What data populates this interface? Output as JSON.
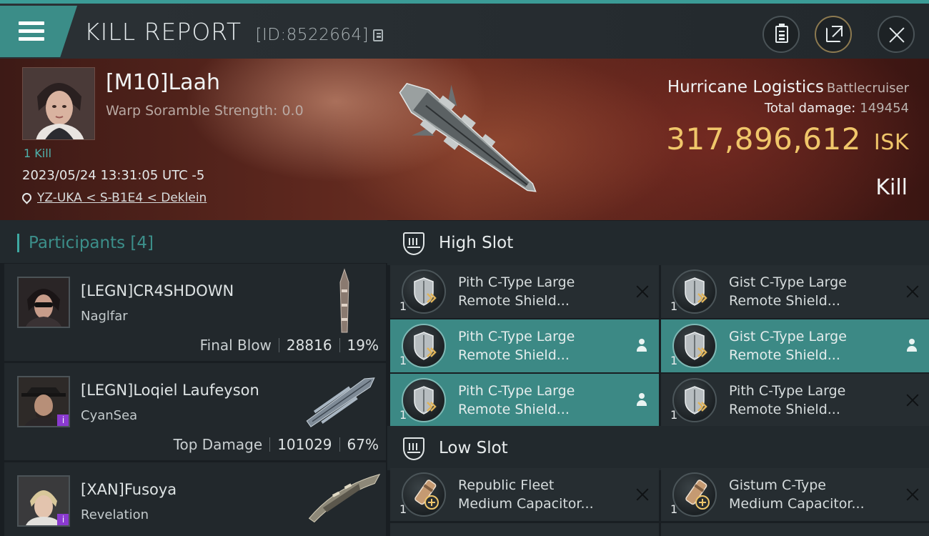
{
  "header": {
    "title": "KILL REPORT",
    "report_id": "[ID:8522664]"
  },
  "victim": {
    "name": "[M10]Laah",
    "warp_scramble": "Warp Soramble Strength: 0.0",
    "kill_count": "1 Kill",
    "datetime": "2023/05/24 13:31:05 UTC -5",
    "location": "YZ-UKA < S-B1E4 < Deklein",
    "ship_name": "Hurricane Logistics",
    "ship_class": "Battlecruiser",
    "total_damage_label": "Total damage:",
    "total_damage": "149454",
    "isk_value": "317,896,612",
    "isk_unit": "ISK",
    "result": "Kill"
  },
  "participants": {
    "label": "Participants",
    "count": "[4]",
    "items": [
      {
        "name": "[LEGN]CR4SHDOWN",
        "ship": "Naglfar",
        "tag": "Final Blow",
        "damage": "28816",
        "percent": "19%"
      },
      {
        "name": "[LEGN]Loqiel Laufeyson",
        "ship": "CyanSea",
        "tag": "Top Damage",
        "damage": "101029",
        "percent": "67%"
      },
      {
        "name": "[XAN]Fusoya",
        "ship": "Revelation"
      }
    ]
  },
  "fitting": {
    "high_slot": {
      "title": "High Slot",
      "modules": [
        {
          "qty": "1",
          "name_line1": "Pith C-Type Large",
          "name_line2": "Remote Shield...",
          "active": false
        },
        {
          "qty": "1",
          "name_line1": "Gist C-Type Large",
          "name_line2": "Remote Shield...",
          "active": false
        },
        {
          "qty": "1",
          "name_line1": "Pith C-Type Large",
          "name_line2": "Remote Shield...",
          "active": true
        },
        {
          "qty": "1",
          "name_line1": "Gist C-Type Large",
          "name_line2": "Remote Shield...",
          "active": true
        },
        {
          "qty": "1",
          "name_line1": "Pith C-Type Large",
          "name_line2": "Remote Shield...",
          "active": true
        },
        {
          "qty": "1",
          "name_line1": "Pith C-Type Large",
          "name_line2": "Remote Shield...",
          "active": false
        }
      ]
    },
    "low_slot": {
      "title": "Low Slot",
      "modules": [
        {
          "qty": "1",
          "name_line1": "Republic Fleet",
          "name_line2": "Medium Capacitor...",
          "active": false
        },
        {
          "qty": "1",
          "name_line1": "Gistum C-Type",
          "name_line2": "Medium Capacitor...",
          "active": false
        }
      ]
    }
  },
  "colors": {
    "accent_teal": "#3b8d88",
    "isk_gold": "#f0c66a",
    "banner_red": "#6e2f22"
  }
}
